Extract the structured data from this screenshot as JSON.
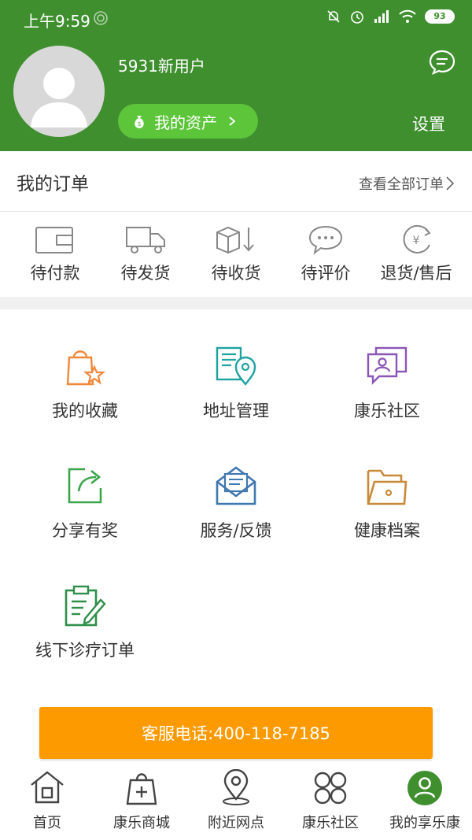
{
  "status_bar": {
    "time": "上午9:59",
    "battery": "93"
  },
  "profile": {
    "username": "5931新用户",
    "assets_label": "我的资产",
    "settings_label": "设置"
  },
  "orders": {
    "title": "我的订单",
    "view_all": "查看全部订单",
    "statuses": [
      {
        "label": "待付款",
        "icon": "wallet-icon"
      },
      {
        "label": "待发货",
        "icon": "truck-icon"
      },
      {
        "label": "待收货",
        "icon": "package-arrow-icon"
      },
      {
        "label": "待评价",
        "icon": "chat-bubble-icon"
      },
      {
        "label": "退货/售后",
        "icon": "refund-icon"
      }
    ]
  },
  "features": [
    {
      "label": "我的收藏",
      "icon": "bag-star-icon",
      "color": "#f0883a"
    },
    {
      "label": "地址管理",
      "icon": "map-pin-doc-icon",
      "color": "#1fa3a0"
    },
    {
      "label": "康乐社区",
      "icon": "community-icon",
      "color": "#8a56b8"
    },
    {
      "label": "分享有奖",
      "icon": "share-icon",
      "color": "#3aa54a"
    },
    {
      "label": "服务/反馈",
      "icon": "envelope-icon",
      "color": "#3f77b0"
    },
    {
      "label": "健康档案",
      "icon": "folder-icon",
      "color": "#c88a3a"
    },
    {
      "label": "线下诊疗订单",
      "icon": "clipboard-icon",
      "color": "#2f8f4a"
    }
  ],
  "hotline": "客服电话:400-118-7185",
  "tabbar": [
    {
      "label": "首页",
      "icon": "home-icon"
    },
    {
      "label": "康乐商城",
      "icon": "shopping-bag-icon"
    },
    {
      "label": "附近网点",
      "icon": "location-icon"
    },
    {
      "label": "康乐社区",
      "icon": "grid-circles-icon"
    },
    {
      "label": "我的享乐康",
      "icon": "profile-icon",
      "active_color": "#3f8f2f"
    }
  ]
}
